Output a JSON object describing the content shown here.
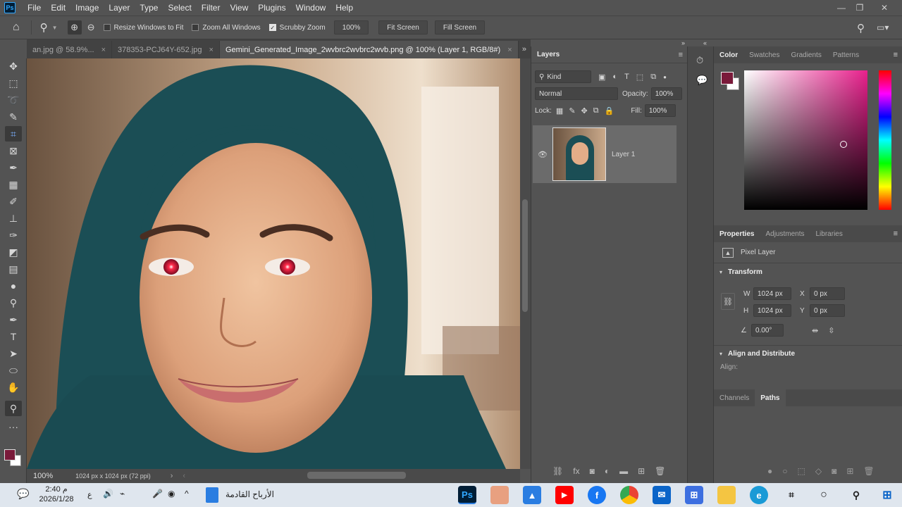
{
  "menubar": {
    "logo": "Ps",
    "items": [
      "File",
      "Edit",
      "Image",
      "Layer",
      "Type",
      "Select",
      "Filter",
      "View",
      "Plugins",
      "Window",
      "Help"
    ]
  },
  "options": {
    "resize_windows": "Resize Windows to Fit",
    "zoom_all": "Zoom All Windows",
    "scrubby_zoom": "Scrubby Zoom",
    "zoom_value": "100%",
    "fit_screen": "Fit Screen",
    "fill_screen": "Fill Screen"
  },
  "tabs": [
    {
      "label": "an.jpg @ 58.9%...",
      "close": "×"
    },
    {
      "label": "378353-PCJ64Y-652.jpg",
      "close": "×"
    },
    {
      "label": "Gemini_Generated_Image_2wvbrc2wvbrc2wvb.png @ 100% (Layer 1, RGB/8#)",
      "close": "×"
    }
  ],
  "status": {
    "zoom": "100%",
    "doc_info": "1024 px x 1024 px (72 ppi)"
  },
  "layers": {
    "title": "Layers",
    "filter_kind": "Kind",
    "blend_mode": "Normal",
    "opacity_label": "Opacity:",
    "opacity_value": "100%",
    "lock_label": "Lock:",
    "fill_label": "Fill:",
    "fill_value": "100%",
    "layer_name": "Layer 1"
  },
  "color_panel": {
    "tabs": [
      "Color",
      "Swatches",
      "Gradients",
      "Patterns"
    ],
    "foreground": "#7a1a3a",
    "hue": "#e8208c"
  },
  "properties": {
    "tabs": [
      "Properties",
      "Adjustments",
      "Libraries"
    ],
    "layer_type": "Pixel Layer",
    "transform_title": "Transform",
    "w_label": "W",
    "w_value": "1024 px",
    "h_label": "H",
    "h_value": "1024 px",
    "x_label": "X",
    "x_value": "0 px",
    "y_label": "Y",
    "y_value": "0 px",
    "angle_value": "0.00°",
    "align_title": "Align and Distribute",
    "align_label": "Align:"
  },
  "bottom_tabs": [
    "Channels",
    "Paths"
  ],
  "taskbar": {
    "time": "2:40 م",
    "date": "2026/1/28",
    "lang": "ع",
    "app_label": "الأرباح القادمة"
  }
}
